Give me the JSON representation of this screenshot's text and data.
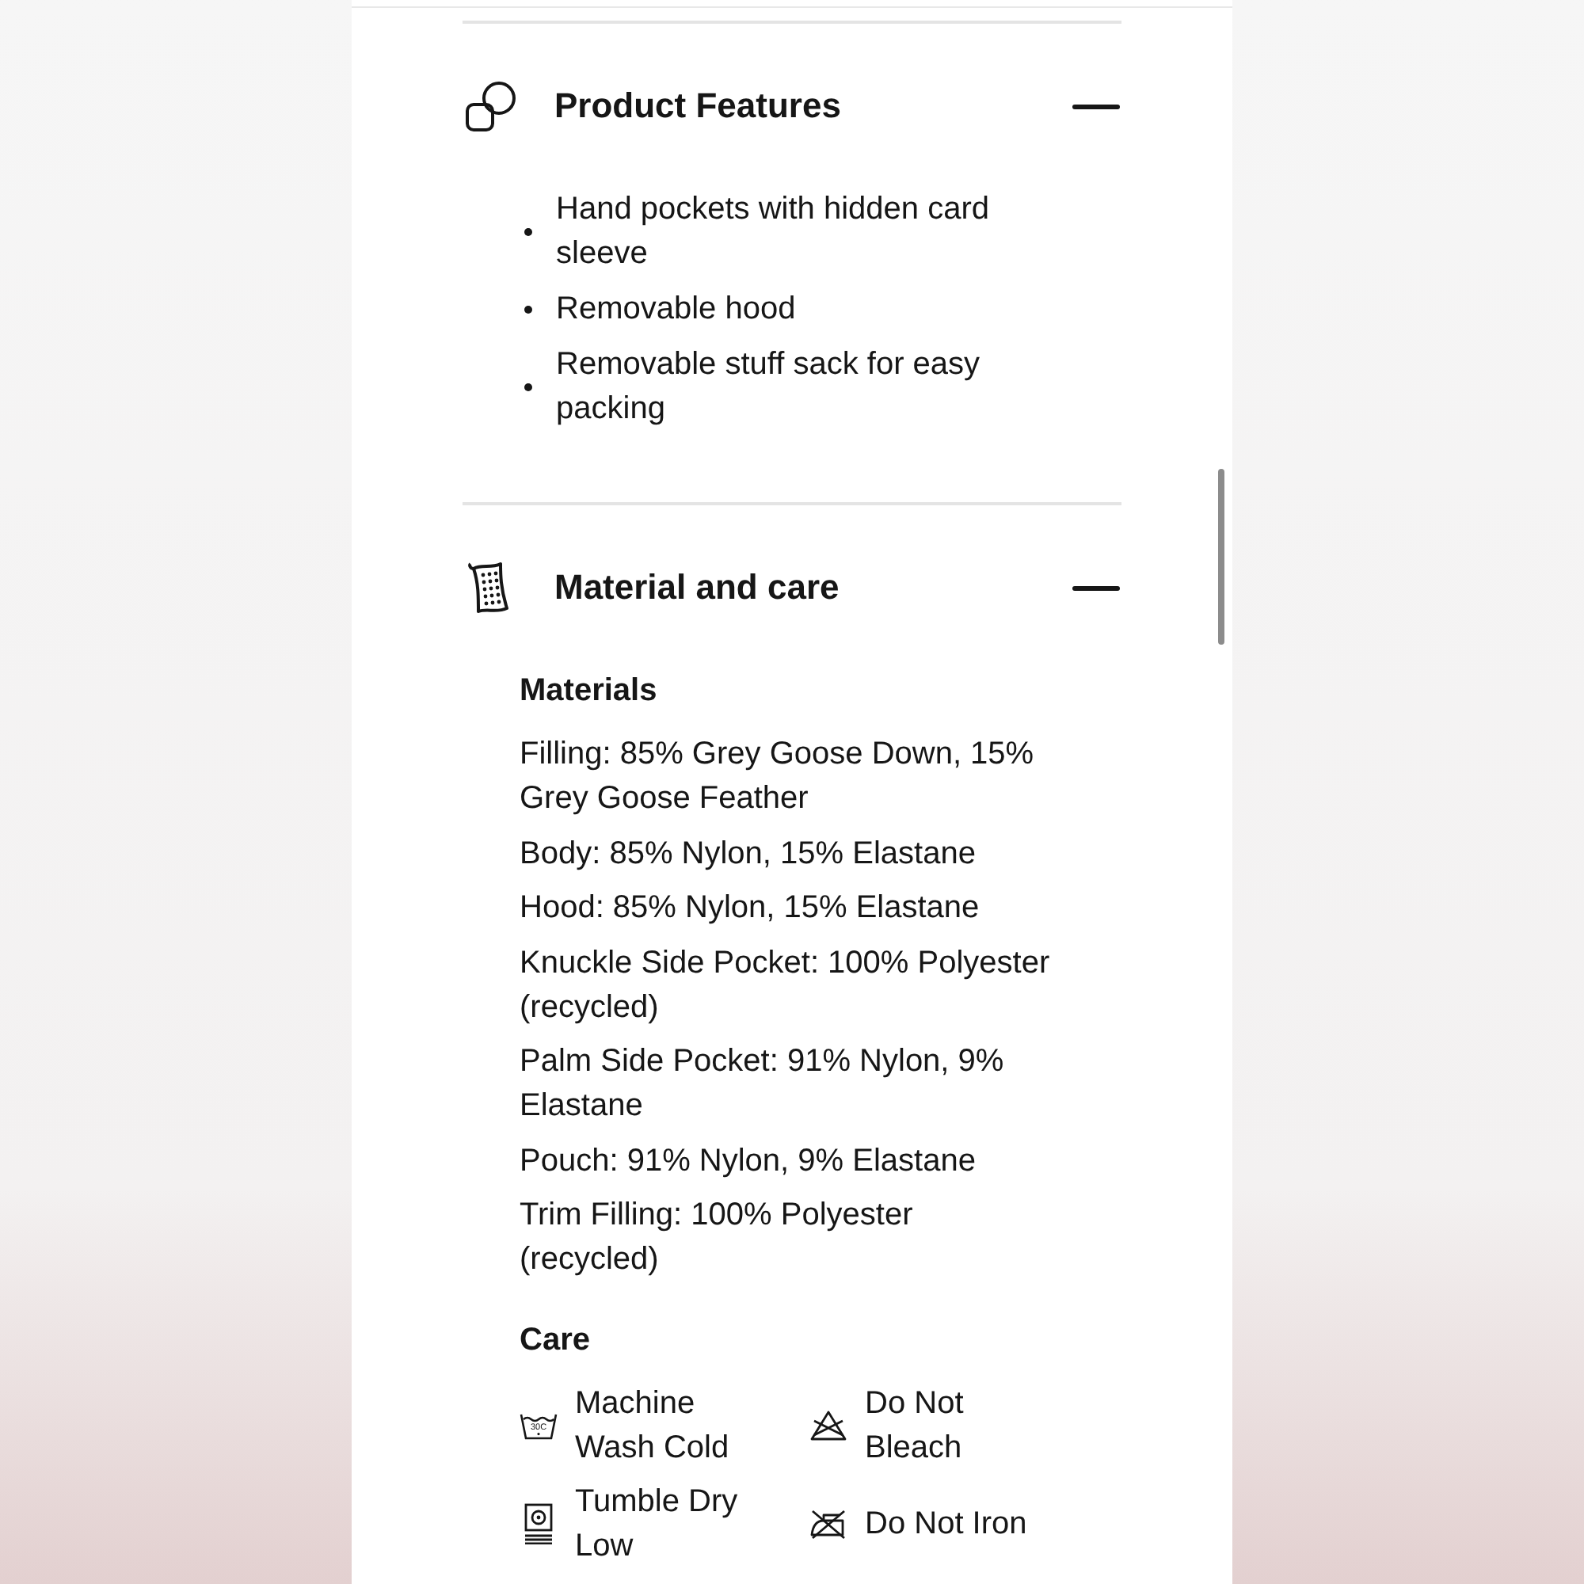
{
  "sections": [
    {
      "kind": "bullets",
      "title": "Product Features",
      "expanded": true,
      "items": [
        "Hand pockets with hidden card sleeve",
        "Removable hood",
        "Removable stuff sack for easy packing"
      ]
    },
    {
      "kind": "details",
      "title": "Material and care",
      "expanded": true,
      "materials": {
        "heading": "Materials",
        "lines": [
          "Filling: 85% Grey Goose Down, 15% Grey Goose Feather",
          "Body: 85% Nylon, 15% Elastane",
          "Hood: 85% Nylon, 15% Elastane",
          "Knuckle Side Pocket: 100% Polyester (recycled)",
          "Palm Side Pocket: 91% Nylon, 9% Elastane",
          "Pouch: 91% Nylon, 9% Elastane",
          "Trim Filling: 100% Polyester (recycled)"
        ]
      },
      "care": {
        "heading": "Care",
        "items": [
          {
            "label": "Machine Wash Cold",
            "symbol_text": "30C"
          },
          {
            "label": "Do Not Bleach"
          },
          {
            "label": "Tumble Dry Low"
          },
          {
            "label": "Do Not Iron"
          }
        ]
      }
    }
  ]
}
